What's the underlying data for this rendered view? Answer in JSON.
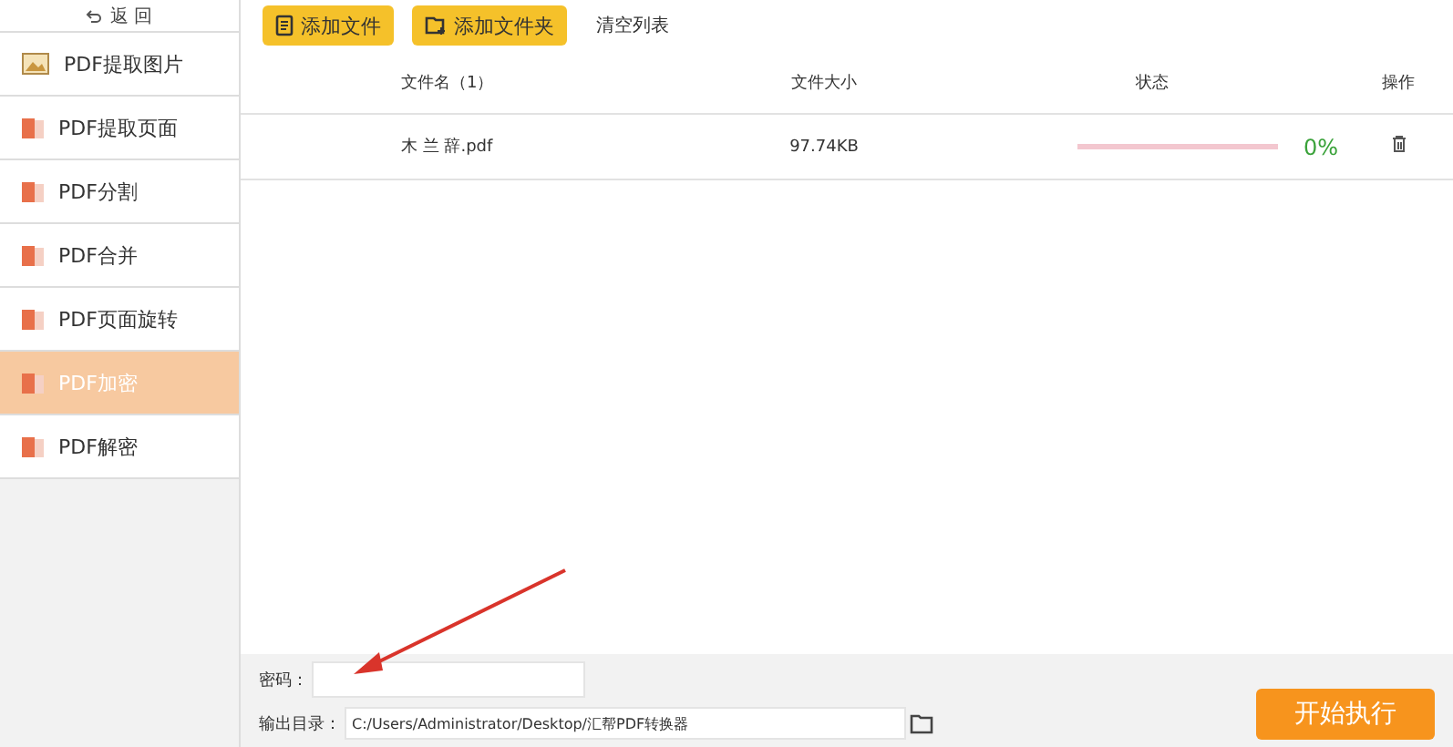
{
  "sidebar": {
    "back": "返 回",
    "items": [
      {
        "label": "PDF提取图片",
        "kind": "image",
        "selected": false
      },
      {
        "label": "PDF提取页面",
        "kind": "pdf",
        "selected": false
      },
      {
        "label": "PDF分割",
        "kind": "pdf",
        "selected": false
      },
      {
        "label": "PDF合并",
        "kind": "pdf",
        "selected": false
      },
      {
        "label": "PDF页面旋转",
        "kind": "pdf",
        "selected": false
      },
      {
        "label": "PDF加密",
        "kind": "pdf",
        "selected": true
      },
      {
        "label": "PDF解密",
        "kind": "pdf",
        "selected": false
      }
    ]
  },
  "toolbar": {
    "add_file": "添加文件",
    "add_folder": "添加文件夹",
    "clear": "清空列表"
  },
  "table": {
    "columns": [
      "文件名（1）",
      "文件大小",
      "状态",
      "操作"
    ],
    "rows": [
      {
        "name": "木 兰 辞.pdf",
        "size": "97.74KB",
        "level": 0,
        "percent": "0%"
      }
    ]
  },
  "password": {
    "label": "密码："
  },
  "output": {
    "label": "输出目录：",
    "value": "C:/Users/Administrator/Desktop/汇帮PDF转换器"
  },
  "start_button": "开始执行"
}
